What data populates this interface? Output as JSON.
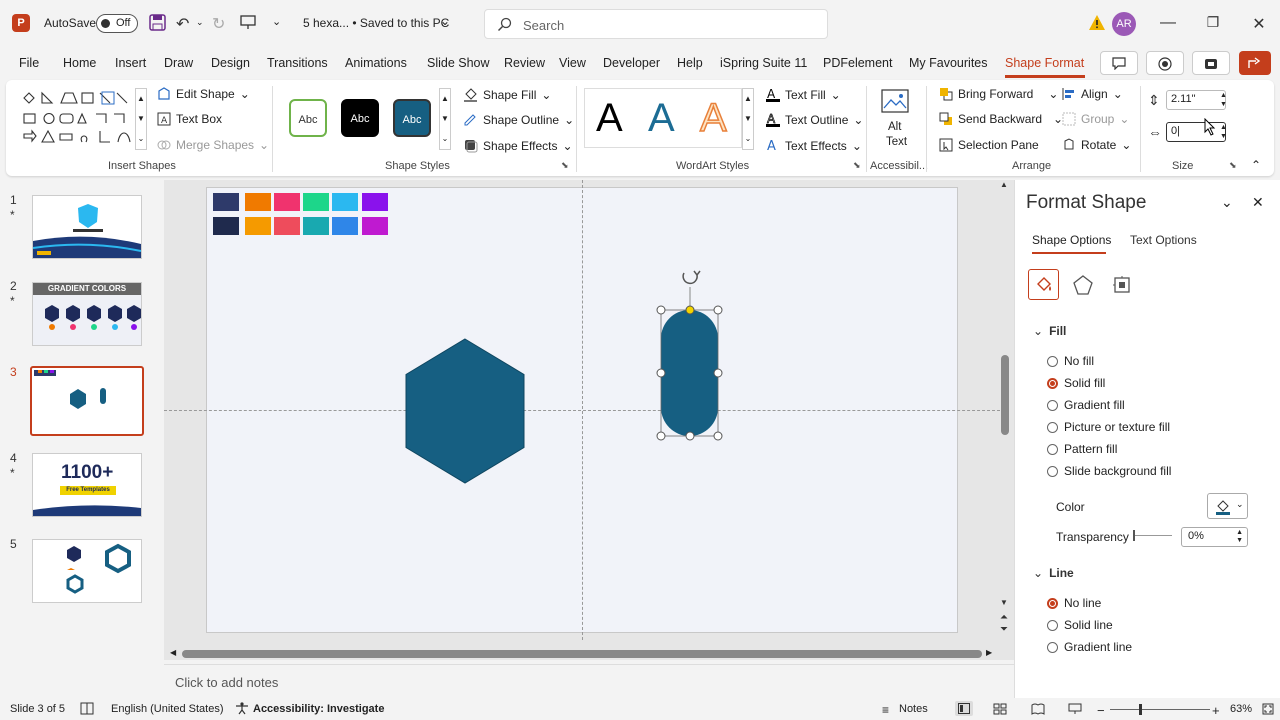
{
  "titlebar": {
    "app_letter": "P",
    "autosave_label": "AutoSave",
    "autosave_state": "Off",
    "doc_title": "5 hexa... • Saved to this PC",
    "search_placeholder": "Search",
    "avatar_initials": "AR"
  },
  "menu": {
    "tabs": [
      "File",
      "Home",
      "Insert",
      "Draw",
      "Design",
      "Transitions",
      "Animations",
      "Slide Show",
      "Review",
      "View",
      "Developer",
      "Help",
      "iSpring Suite 11",
      "PDFelement",
      "My Favourites",
      "Shape Format"
    ],
    "active": "Shape Format"
  },
  "ribbon": {
    "insert_shapes": {
      "label": "Insert Shapes",
      "edit_shape": "Edit Shape",
      "text_box": "Text Box",
      "merge_shapes": "Merge Shapes"
    },
    "shape_styles": {
      "label": "Shape Styles",
      "abc": "Abc",
      "shape_fill": "Shape Fill",
      "shape_outline": "Shape Outline",
      "shape_effects": "Shape Effects"
    },
    "wordart": {
      "label": "WordArt Styles",
      "letter": "A",
      "text_fill": "Text Fill",
      "text_outline": "Text Outline",
      "text_effects": "Text Effects"
    },
    "accessibility": {
      "label": "Accessibil...",
      "alt_text_1": "Alt",
      "alt_text_2": "Text"
    },
    "arrange": {
      "label": "Arrange",
      "bring_forward": "Bring Forward",
      "send_backward": "Send Backward",
      "selection_pane": "Selection Pane",
      "align": "Align",
      "group": "Group",
      "rotate": "Rotate"
    },
    "size": {
      "label": "Size",
      "height": "2.11\"",
      "width": "0|"
    }
  },
  "thumbnails": [
    {
      "num": "1",
      "star": "*"
    },
    {
      "num": "2",
      "star": "*",
      "title": "GRADIENT COLORS"
    },
    {
      "num": "3",
      "star": ""
    },
    {
      "num": "4",
      "star": "*",
      "title": "1100+",
      "sub": "Free Templates"
    },
    {
      "num": "5",
      "star": ""
    }
  ],
  "slide": {
    "swatches_row1": [
      "#2e3a6a",
      "#f07a00",
      "#f0336e",
      "#1dd68a",
      "#2bb8f0",
      "#8a12ec"
    ],
    "swatches_row2": [
      "#1f2a4d",
      "#f59a00",
      "#ee4c5c",
      "#19a9b0",
      "#2f86e8",
      "#bf1ad0"
    ],
    "shape_color": "#165f82"
  },
  "notes_placeholder": "Click to add notes",
  "pane": {
    "title": "Format Shape",
    "tab_shape": "Shape Options",
    "tab_text": "Text Options",
    "fill_header": "Fill",
    "fill_options": [
      "No fill",
      "Solid fill",
      "Gradient fill",
      "Picture or texture fill",
      "Pattern fill",
      "Slide background fill"
    ],
    "fill_selected": 1,
    "color_label": "Color",
    "transparency_label": "Transparency",
    "transparency_value": "0%",
    "line_header": "Line",
    "line_options": [
      "No line",
      "Solid line",
      "Gradient line"
    ],
    "line_selected": 0
  },
  "status": {
    "slide_info": "Slide 3 of 5",
    "language": "English (United States)",
    "accessibility": "Accessibility: Investigate",
    "notes": "Notes",
    "zoom": "63%"
  },
  "colors": {
    "accent": "#c43e1c"
  }
}
